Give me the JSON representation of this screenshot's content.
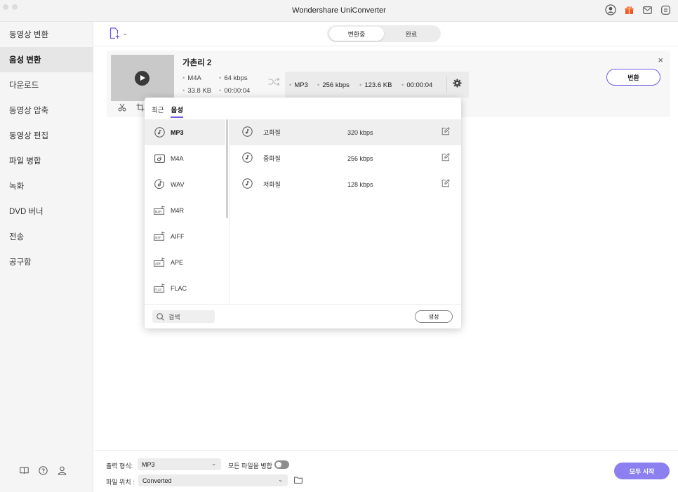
{
  "window": {
    "title": "Wondershare UniConverter"
  },
  "sidebar": {
    "items": [
      {
        "label": "동영상 변환"
      },
      {
        "label": "음성 변환"
      },
      {
        "label": "다운로드"
      },
      {
        "label": "동영상 압축"
      },
      {
        "label": "동영상 편집"
      },
      {
        "label": "파일 병합"
      },
      {
        "label": "녹화"
      },
      {
        "label": "DVD 버너"
      },
      {
        "label": "전송"
      },
      {
        "label": "공구함"
      }
    ],
    "active_item": "음성 변환",
    "bottom_icons": [
      "book-icon",
      "help-icon",
      "account-icon"
    ]
  },
  "toolbar": {
    "tabs": [
      {
        "label": "변환중"
      },
      {
        "label": "완료"
      }
    ],
    "active_tab": "변환중"
  },
  "file": {
    "name": "가촌리 2",
    "source": {
      "format": "M4A",
      "bitrate": "64 kbps",
      "size": "33.8 KB",
      "duration": "00:00:04"
    },
    "target": {
      "format": "MP3",
      "bitrate": "256 kbps",
      "size": "123.6 KB",
      "duration": "00:00:04"
    },
    "convert_label": "변환",
    "close_label": "×"
  },
  "format_panel": {
    "tabs": [
      {
        "label": "최근"
      },
      {
        "label": "음성"
      }
    ],
    "active_tab": "음성",
    "formats": [
      {
        "label": "MP3",
        "icon": "mp3-icon"
      },
      {
        "label": "M4A",
        "icon": "m4a-icon"
      },
      {
        "label": "WAV",
        "icon": "wav-icon"
      },
      {
        "label": "M4R",
        "icon": "m4r-icon"
      },
      {
        "label": "AIFF",
        "icon": "aiff-icon"
      },
      {
        "label": "APE",
        "icon": "ape-icon"
      },
      {
        "label": "FLAC",
        "icon": "flac-icon"
      }
    ],
    "selected_format": "MP3",
    "qualities": [
      {
        "name": "고화질",
        "bitrate": "320 kbps"
      },
      {
        "name": "중화질",
        "bitrate": "256 kbps"
      },
      {
        "name": "저화질",
        "bitrate": "128 kbps"
      }
    ],
    "selected_quality": "고화질",
    "search_placeholder": "검색",
    "create_label": "생성"
  },
  "bottom": {
    "output_format_label": "출력 형식:",
    "output_format_value": "MP3",
    "merge_label": "모든 파일을 병합",
    "merge_enabled": false,
    "location_label": "파일 위치 :",
    "location_value": "Converted",
    "start_all_label": "모두 시작"
  },
  "colors": {
    "accent": "#6c5ce7",
    "start_button": "#8c80f0"
  }
}
